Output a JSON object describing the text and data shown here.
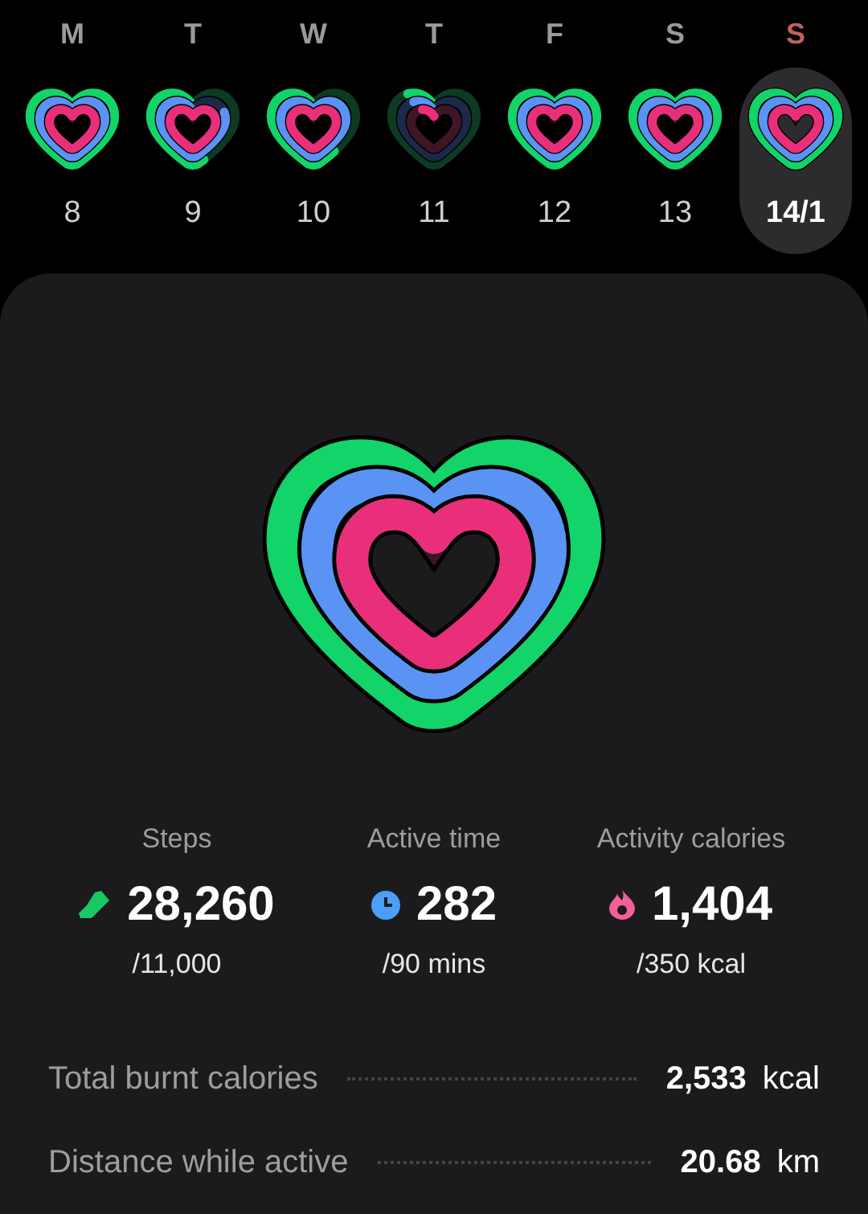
{
  "days": [
    {
      "letter": "M",
      "color": "#9a9a9a",
      "date": "8",
      "selected": false
    },
    {
      "letter": "T",
      "color": "#9a9a9a",
      "date": "9",
      "selected": false
    },
    {
      "letter": "W",
      "color": "#9a9a9a",
      "date": "10",
      "selected": false
    },
    {
      "letter": "T",
      "color": "#9a9a9a",
      "date": "11",
      "selected": false
    },
    {
      "letter": "F",
      "color": "#9a9a9a",
      "date": "12",
      "selected": false
    },
    {
      "letter": "S",
      "color": "#9a9a9a",
      "date": "13",
      "selected": false
    },
    {
      "letter": "S",
      "color": "#c2605e",
      "date": "14/1",
      "selected": true
    }
  ],
  "stats": [
    {
      "kind": "steps",
      "label": "Steps",
      "value": "28,260",
      "goal": "/11,000"
    },
    {
      "kind": "time",
      "label": "Active time",
      "value": "282",
      "goal": "/90 mins"
    },
    {
      "kind": "calories",
      "label": "Activity calories",
      "value": "1,404",
      "goal": "/350 kcal"
    }
  ],
  "details": [
    {
      "label": "Total burnt calories",
      "value": "2,533",
      "unit": "kcal"
    },
    {
      "label": "Distance while active",
      "value": "20.68",
      "unit": "km"
    }
  ]
}
